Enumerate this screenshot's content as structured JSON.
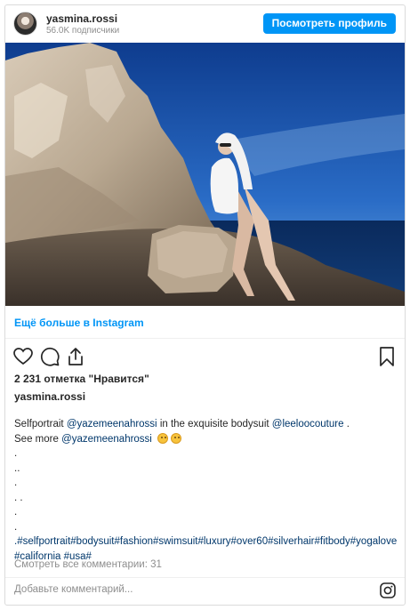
{
  "header": {
    "username": "yasmina.rossi",
    "followers": "56.0K подписчики",
    "view_profile": "Посмотреть профиль"
  },
  "more_link": "Ещё больше в Instagram",
  "likes": "2 231 отметка \"Нравится\"",
  "author": "yasmina.rossi",
  "caption": {
    "line1_text": "Selfportrait ",
    "line1_mention1": "@yazemeenahrossi",
    "line1_mid": " in the exquisite bodysuit ",
    "line1_mention2": "@leeloocouture",
    "line1_end": " .",
    "line2_text": "See more ",
    "line2_mention": "@yazemeenahrossi",
    "dot_lines": [
      ".",
      "..",
      ".",
      ". .",
      ".",
      "."
    ],
    "hashtags_line1": ".#selfportrait#bodysuit#fashion#swimsuit#luxury#over60#silverhair#fitbody#yogalove",
    "hashtags_line2": "#california #usa#"
  },
  "view_comments": "Смотреть все комментарии: 31",
  "add_comment_placeholder": "Добавьте комментарий...",
  "icons": [
    "heart-icon",
    "comment-icon",
    "share-icon",
    "bookmark-icon",
    "instagram-icon"
  ],
  "colors": {
    "accent": "#0095f6",
    "link": "#00376b",
    "muted": "#8e8e8e"
  }
}
